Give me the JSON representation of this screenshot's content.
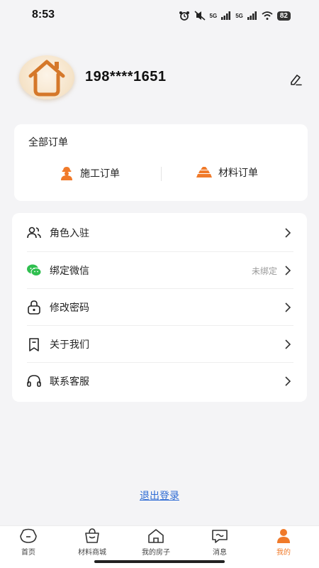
{
  "status_bar": {
    "time": "8:53",
    "signal_1": "5G",
    "signal_2": "5G",
    "battery": "82"
  },
  "profile": {
    "phone": "198****1651"
  },
  "orders": {
    "title": "全部订单",
    "construction_label": "施工订单",
    "material_label": "材料订单"
  },
  "menu": {
    "items": [
      {
        "label": "角色入驻",
        "value": "",
        "icon": "users-icon"
      },
      {
        "label": "绑定微信",
        "value": "未绑定",
        "icon": "wechat-icon"
      },
      {
        "label": "修改密码",
        "value": "",
        "icon": "lock-icon"
      },
      {
        "label": "关于我们",
        "value": "",
        "icon": "bookmark-icon"
      },
      {
        "label": "联系客服",
        "value": "",
        "icon": "headset-icon"
      }
    ]
  },
  "logout_label": "退出登录",
  "tabs": [
    {
      "label": "首页",
      "icon": "home-tab-icon",
      "active": false
    },
    {
      "label": "材料商城",
      "icon": "bag-icon",
      "active": false
    },
    {
      "label": "我的房子",
      "icon": "house-icon",
      "active": false
    },
    {
      "label": "消息",
      "icon": "message-icon",
      "active": false
    },
    {
      "label": "我的",
      "icon": "person-icon",
      "active": true
    }
  ],
  "colors": {
    "accent": "#f07a2a",
    "link": "#2f6cd4",
    "wechat": "#2fbf4f"
  }
}
